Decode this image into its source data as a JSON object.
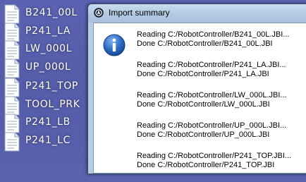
{
  "desktop": {
    "files": [
      {
        "label": "B241_00L",
        "icon": "document-icon"
      },
      {
        "label": "P241_LA",
        "icon": "document-icon"
      },
      {
        "label": "LW_000L",
        "icon": "document-icon"
      },
      {
        "label": "UP_000L",
        "icon": "document-icon"
      },
      {
        "label": "P241_TOP",
        "icon": "document-icon"
      },
      {
        "label": "TOOL_PRK",
        "icon": "document-icon"
      },
      {
        "label": "P241_LB",
        "icon": "document-icon"
      },
      {
        "label": "P241_LC",
        "icon": "document-icon"
      }
    ]
  },
  "dialog": {
    "title": "Import summary",
    "title_icon": "app-icon",
    "body_icon": "info-icon",
    "messages": [
      {
        "reading": "Reading C:/RobotController/B241_00L.JBI...",
        "done": "Done C:/RobotController/B241_00L.JBI"
      },
      {
        "reading": "Reading C:/RobotController/P241_LA.JBI...",
        "done": "Done C:/RobotController/P241_LA.JBI"
      },
      {
        "reading": "Reading C:/RobotController/LW_000L.JBI...",
        "done": "Done C:/RobotController/LW_000L.JBI"
      },
      {
        "reading": "Reading C:/RobotController/UP_000L.JBI...",
        "done": "Done C:/RobotController/UP_000L.JBI"
      },
      {
        "reading": "Reading C:/RobotController/P241_TOP.JBI...",
        "done": "Done C:/RobotController/P241_TOP.JBI"
      }
    ]
  }
}
